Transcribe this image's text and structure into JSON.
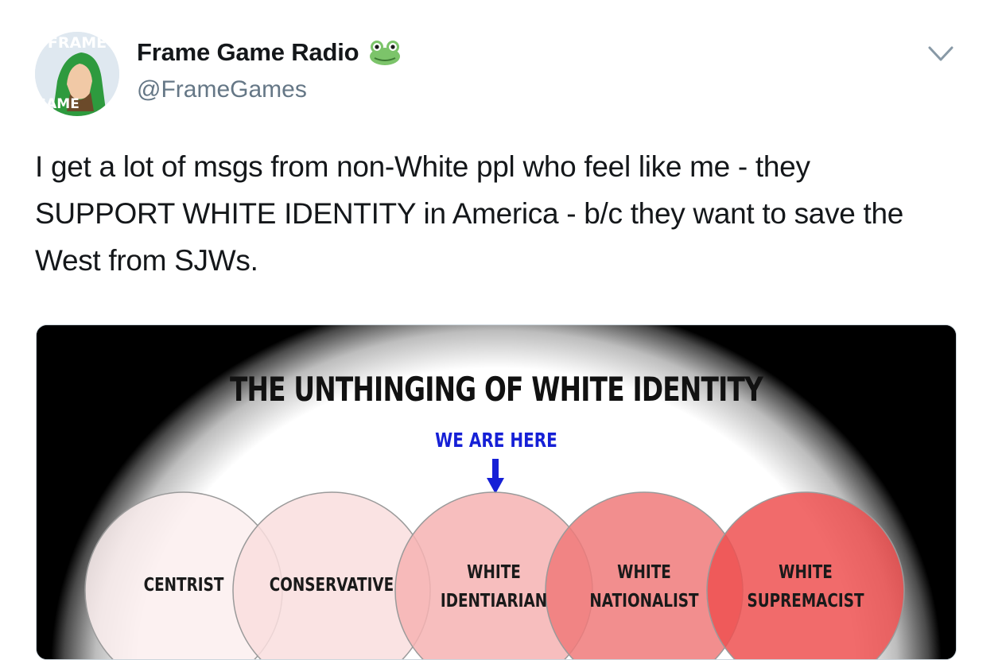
{
  "author": {
    "display_name": "Frame Game Radio",
    "handle": "@FrameGames",
    "avatar_text_top": "FRAME",
    "avatar_text_bottom": "GAME",
    "name_emoji": "frog-face-icon"
  },
  "tweet": {
    "text": "I get a lot of msgs from non-White ppl who feel like me - they\nSUPPORT WHITE IDENTITY in America - b/c they want to save the\nWest from SJWs."
  },
  "media": {
    "title": "THE UNTHINGING OF WHITE IDENTITY",
    "marker_label": "WE ARE HERE",
    "circles": [
      {
        "line1": "CENTRIST",
        "line2": "",
        "color": "#fbeeee"
      },
      {
        "line1": "CONSERVATIVE",
        "line2": "",
        "color": "#f9dede"
      },
      {
        "line1": "WHITE",
        "line2": "IDENTIARIAN",
        "color": "#f6b3b3"
      },
      {
        "line1": "WHITE",
        "line2": "NATIONALIST",
        "color": "#f07a7a"
      },
      {
        "line1": "WHITE",
        "line2": "SUPREMACIST",
        "color": "#ee5151"
      }
    ],
    "marker_color": "#1620d6"
  },
  "colors": {
    "text": "#14171a",
    "handle": "#657786",
    "border": "#ccd6dd"
  },
  "icons": {
    "caret": "chevron-down-icon"
  }
}
